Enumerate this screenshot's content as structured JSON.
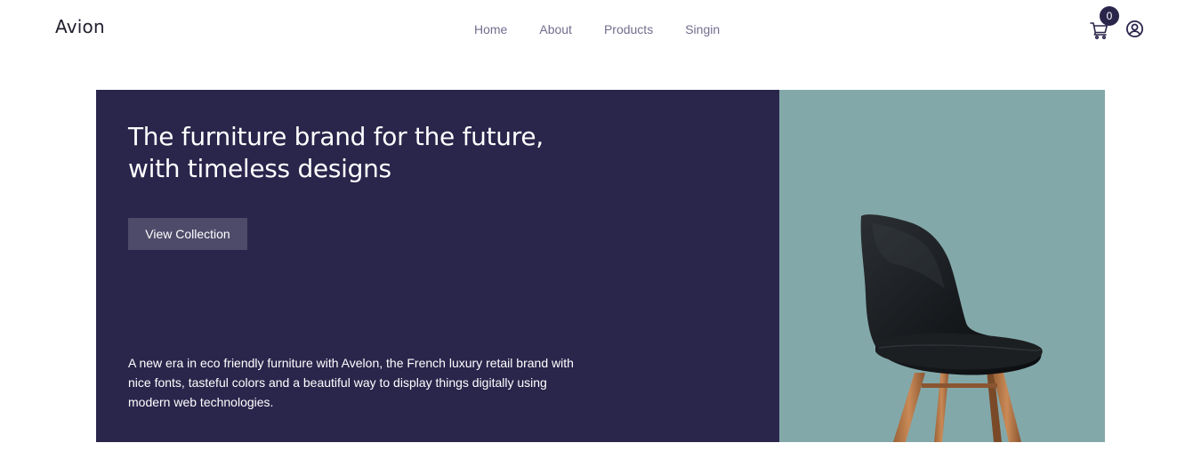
{
  "header": {
    "logo": "Avion",
    "nav": [
      "Home",
      "About",
      "Products",
      "Singin"
    ],
    "cart_count": "0",
    "cart_icon": "shopping-cart-icon",
    "user_icon": "user-circle-icon"
  },
  "hero": {
    "title": "The furniture brand for the future, with timeless designs",
    "cta_label": "View Collection",
    "description": "A new era in eco friendly furniture with Avelon, the French luxury retail brand with nice fonts, tasteful colors and a beautiful way to display things digitally using modern web technologies.",
    "image": "chair-image"
  },
  "colors": {
    "primary_dark": "#2A254B",
    "button": "#4E4B6A",
    "image_bg": "#83A8AA",
    "nav_text": "#726E8D"
  }
}
